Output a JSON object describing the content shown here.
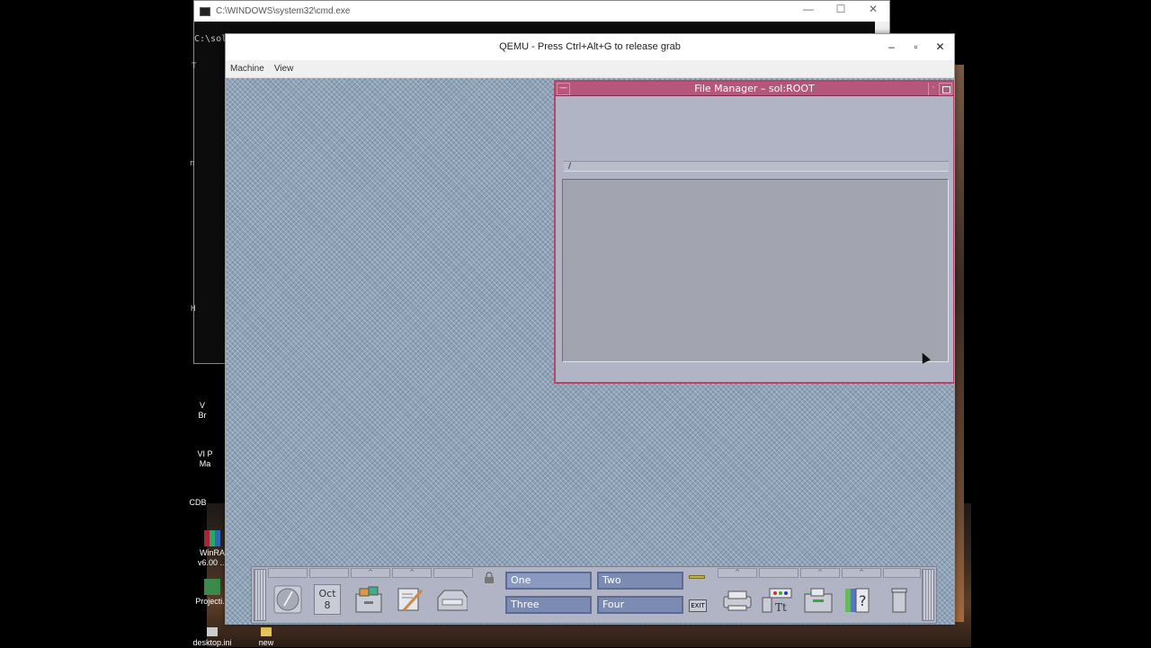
{
  "cmd": {
    "title": "C:\\WINDOWS\\system32\\cmd.exe",
    "prompt_text": "C:\\sol",
    "controls": [
      "—",
      "☐",
      "✕"
    ],
    "fragments": [
      "T",
      "n",
      "H"
    ]
  },
  "qemu": {
    "title": "QEMU - Press Ctrl+Alt+G to release grab",
    "controls": [
      "–",
      "▫",
      "✕"
    ],
    "menu": [
      "Machine",
      "View"
    ]
  },
  "file_manager": {
    "title": "File Manager – sol:ROOT",
    "path": "/"
  },
  "panel": {
    "calendar_month": "Oct",
    "calendar_day": "8",
    "workspaces": [
      "One",
      "Two",
      "Three",
      "Four"
    ],
    "exit_label": "EXIT"
  },
  "desktop_icons": [
    {
      "label": "V\nBr",
      "icon": "app-icon"
    },
    {
      "label": "VI P\nMa",
      "icon": "app-icon"
    },
    {
      "label": "CDB",
      "icon": "app-icon"
    },
    {
      "label": "WinRA\nv6.00 ...",
      "icon": "winrar-icon"
    },
    {
      "label": "Projecti...",
      "icon": "project-icon"
    },
    {
      "label": "desktop.ini",
      "icon": "file-icon"
    },
    {
      "label": "new",
      "icon": "folder-icon"
    }
  ],
  "colors": {
    "fm_border": "#b4466e",
    "fm_title": "#b4577a",
    "cde_bg": "#8fa3b8",
    "panel": "#b0b4c4",
    "workspace": "#7c8bb1"
  }
}
